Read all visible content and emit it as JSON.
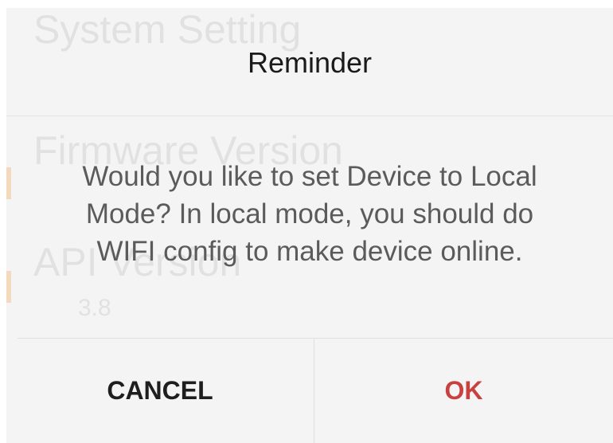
{
  "background_screen": {
    "title": "System Setting",
    "firmware_label": "Firmware Version",
    "api_label": "API Version",
    "api_value": "3.8"
  },
  "dialog": {
    "title": "Reminder",
    "message": "Would you like to set Device to Local Mode? In local mode, you should do WIFI config to make device online.",
    "cancel_label": "CANCEL",
    "ok_label": "OK"
  },
  "colors": {
    "dialog_background": "#f4f4f4",
    "ok_accent": "#c8413f",
    "message_text": "#5b5b5b"
  }
}
